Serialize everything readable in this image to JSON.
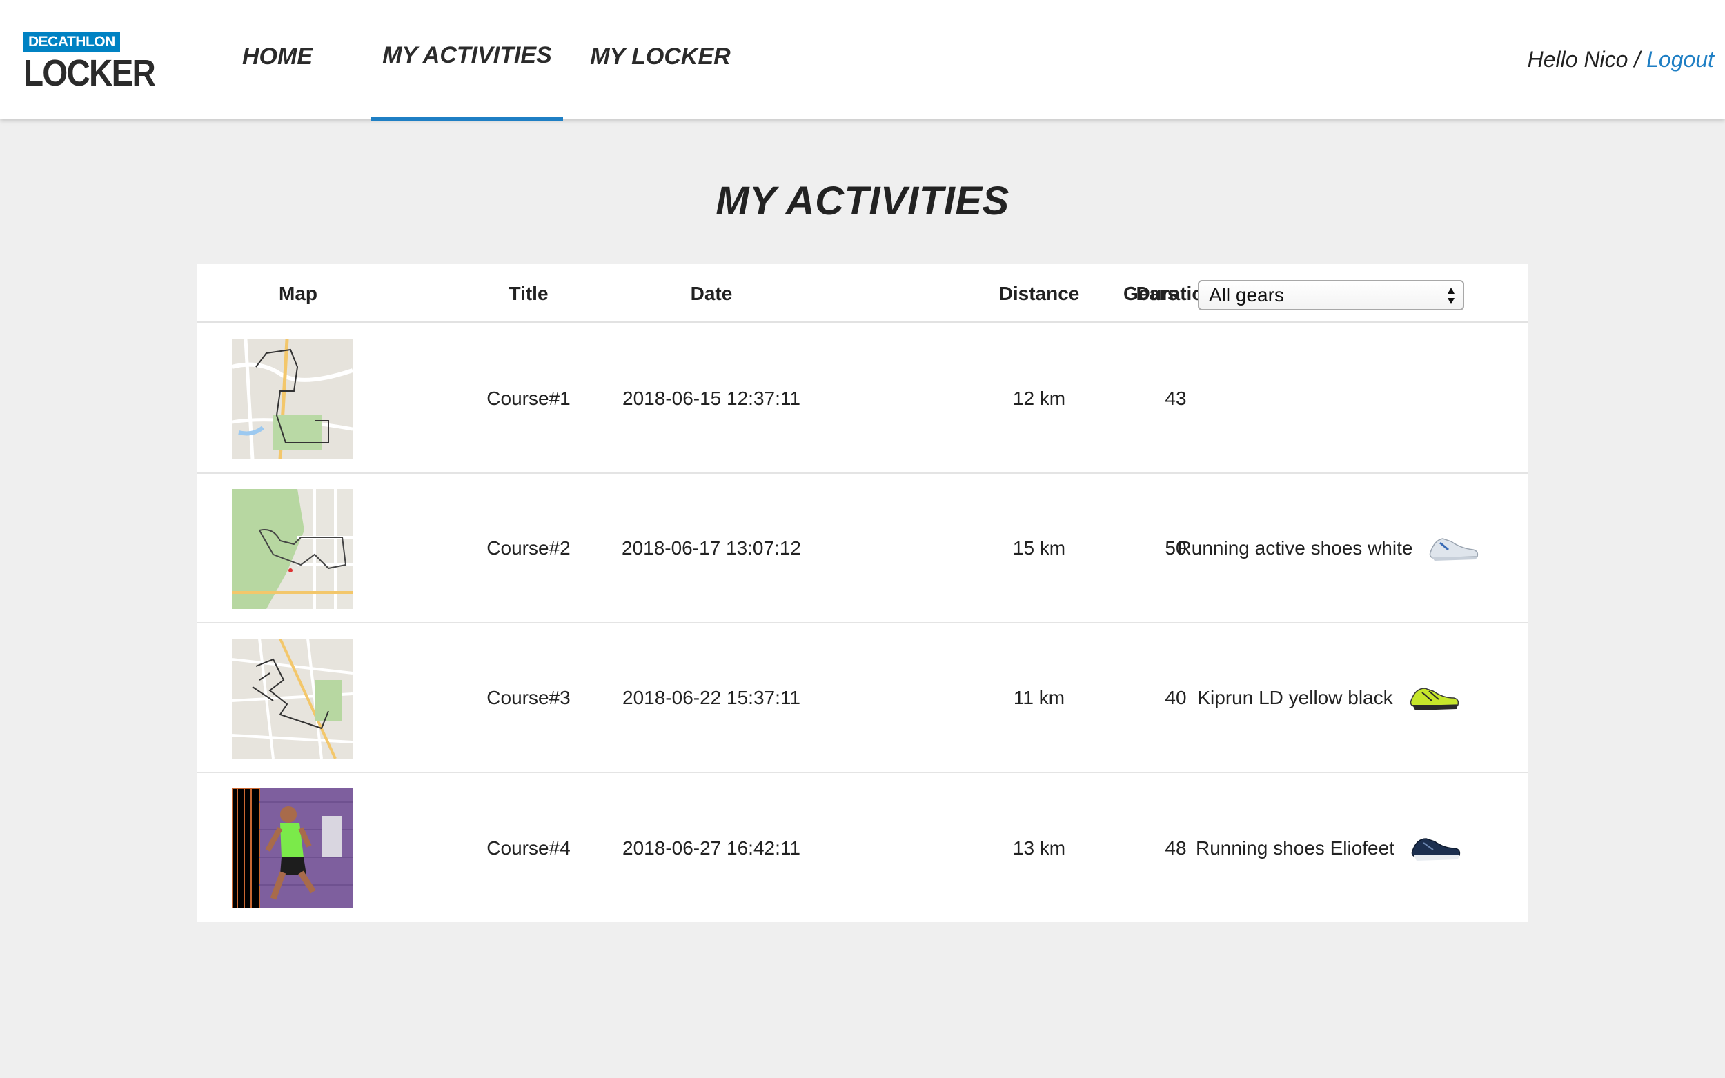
{
  "brand": {
    "badge": "DECATHLON",
    "word": "LOCKER"
  },
  "nav": {
    "home": "HOME",
    "activities": "MY ACTIVITIES",
    "locker": "MY LOCKER",
    "active": "MY ACTIVITIES"
  },
  "user": {
    "greeting": "Hello Nico /",
    "logout": "Logout"
  },
  "page_title": "MY ACTIVITIES",
  "table": {
    "headers": {
      "map": "Map",
      "title": "Title",
      "date": "Date",
      "distance": "Distance",
      "duration": "Duration",
      "gears": "Gears"
    },
    "gear_filter": {
      "selected": "All gears"
    },
    "rows": [
      {
        "map": "route-map-thumbnail",
        "title": "Course#1",
        "date": "2018-06-15 12:37:11",
        "distance": "12 km",
        "duration": "43",
        "gear": "",
        "gear_icon": ""
      },
      {
        "map": "route-map-thumbnail",
        "title": "Course#2",
        "date": "2018-06-17 13:07:12",
        "distance": "15 km",
        "duration": "50",
        "gear": "Running active shoes white",
        "gear_icon": "white-running-shoe-icon"
      },
      {
        "map": "route-map-thumbnail",
        "title": "Course#3",
        "date": "2018-06-22 15:37:11",
        "distance": "11 km",
        "duration": "40",
        "gear": "Kiprun LD yellow black",
        "gear_icon": "yellow-running-shoe-icon"
      },
      {
        "map": "runner-photo-thumbnail",
        "title": "Course#4",
        "date": "2018-06-27 16:42:11",
        "distance": "13 km",
        "duration": "48",
        "gear": "Running shoes Eliofeet",
        "gear_icon": "navy-running-shoe-icon"
      }
    ]
  },
  "colors": {
    "brand_blue": "#0082c3",
    "accent_blue": "#1f7fc4",
    "page_bg": "#efefef",
    "shoe_white": "#dfe5ec",
    "shoe_yellow": "#c6e62b",
    "shoe_navy": "#1c2f4f"
  }
}
